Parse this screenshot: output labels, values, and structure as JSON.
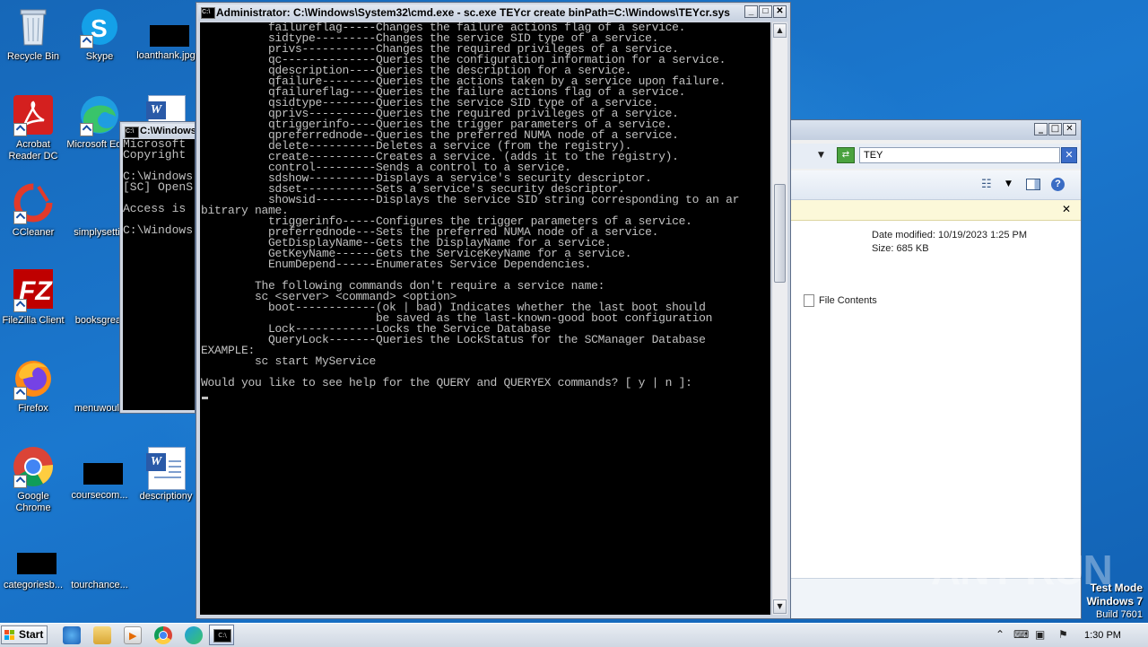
{
  "desktop": {
    "icons": [
      {
        "label": "Recycle Bin"
      },
      {
        "label": "Skype"
      },
      {
        "label": "loanthank.jpg"
      },
      {
        "label": "Acrobat Reader DC"
      },
      {
        "label": "Microsoft Edge"
      },
      {
        "label": "CCleaner"
      },
      {
        "label": "simplysettin"
      },
      {
        "label": "FileZilla Client"
      },
      {
        "label": "booksgreat"
      },
      {
        "label": "Firefox"
      },
      {
        "label": "menuwould"
      },
      {
        "label": "Google Chrome"
      },
      {
        "label": "coursecom..."
      },
      {
        "label": "descriptiony"
      },
      {
        "label": "categoriesb..."
      },
      {
        "label": "tourchance..."
      }
    ]
  },
  "cmd_main": {
    "title": "Administrator: C:\\Windows\\System32\\cmd.exe - sc.exe  TEYcr create binPath=C:\\Windows\\TEYcr.sys",
    "lines": [
      "          failureflag-----Changes the failure actions flag of a service.",
      "          sidtype---------Changes the service SID type of a service.",
      "          privs-----------Changes the required privileges of a service.",
      "          qc--------------Queries the configuration information for a service.",
      "          qdescription----Queries the description for a service.",
      "          qfailure--------Queries the actions taken by a service upon failure.",
      "          qfailureflag----Queries the failure actions flag of a service.",
      "          qsidtype--------Queries the service SID type of a service.",
      "          qprivs----------Queries the required privileges of a service.",
      "          qtriggerinfo----Queries the trigger parameters of a service.",
      "          qpreferrednode--Queries the preferred NUMA node of a service.",
      "          delete----------Deletes a service (from the registry).",
      "          create----------Creates a service. (adds it to the registry).",
      "          control---------Sends a control to a service.",
      "          sdshow----------Displays a service's security descriptor.",
      "          sdset-----------Sets a service's security descriptor.",
      "          showsid---------Displays the service SID string corresponding to an ar",
      "bitrary name.",
      "          triggerinfo-----Configures the trigger parameters of a service.",
      "          preferrednode---Sets the preferred NUMA node of a service.",
      "          GetDisplayName--Gets the DisplayName for a service.",
      "          GetKeyName------Gets the ServiceKeyName for a service.",
      "          EnumDepend------Enumerates Service Dependencies.",
      "",
      "        The following commands don't require a service name:",
      "        sc <server> <command> <option>",
      "          boot------------(ok | bad) Indicates whether the last boot should",
      "                          be saved as the last-known-good boot configuration",
      "          Lock------------Locks the Service Database",
      "          QueryLock-------Queries the LockStatus for the SCManager Database",
      "EXAMPLE:",
      "        sc start MyService",
      "",
      "Would you like to see help for the QUERY and QUERYEX commands? [ y | n ]:"
    ]
  },
  "cmd_back": {
    "title": "C:\\Windows",
    "lines": [
      "Microsoft",
      "Copyright",
      "",
      "C:\\Windows",
      "[SC] OpenS",
      "",
      "Access is",
      "",
      "C:\\Windows"
    ]
  },
  "explorer": {
    "search_value": "TEY",
    "date_modified": "Date modified: 10/19/2023 1:25 PM",
    "size": "Size: 685 KB",
    "file_contents": "File Contents"
  },
  "watermark": "ANY RUN",
  "system": {
    "test_mode": "Test Mode",
    "os": "Windows 7",
    "build": "Build 7601"
  },
  "taskbar": {
    "start_label": "Start",
    "clock": "1:30 PM"
  }
}
